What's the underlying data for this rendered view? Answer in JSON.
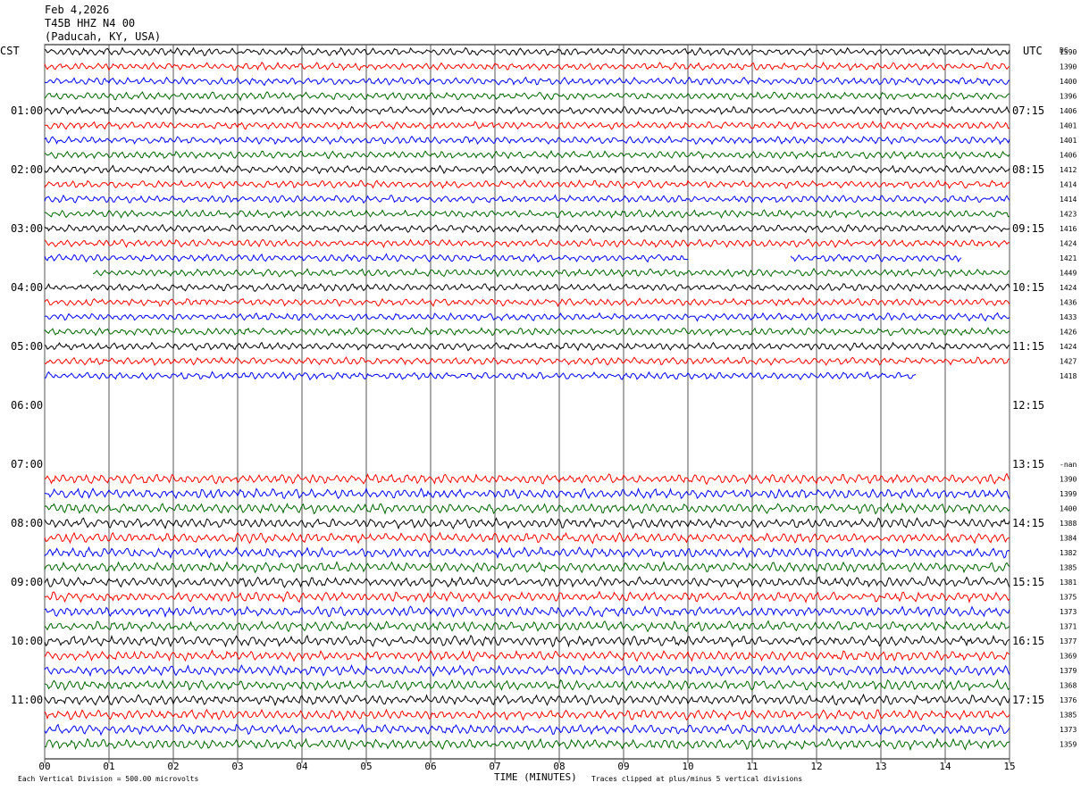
{
  "header": {
    "date": "Feb 4,2026",
    "station": "T45B HHZ N4 00",
    "location": "(Paducah, KY, USA)"
  },
  "left_tz": "CST",
  "right_tz": "UTC",
  "dc_label": "DC",
  "footer": {
    "vertical_division": "Each Vertical Division =  500.00 microvolts",
    "xlabel": "TIME (MINUTES)",
    "clip_note": "Traces clipped at plus/minus 5 vertical divisions"
  },
  "chart_data": {
    "type": "line",
    "title": "T45B HHZ N4 00",
    "xlabel": "TIME (MINUTES)",
    "xlim": [
      0,
      15
    ],
    "x_ticks": [
      "00",
      "01",
      "02",
      "03",
      "04",
      "05",
      "06",
      "07",
      "08",
      "09",
      "10",
      "11",
      "12",
      "13",
      "14",
      "15"
    ],
    "row_count": 48,
    "rows_per_hour": 4,
    "left_hour_labels": [
      "01:00",
      "02:00",
      "03:00",
      "04:00",
      "05:00",
      "06:00",
      "07:00",
      "08:00",
      "09:00",
      "10:00",
      "11:00"
    ],
    "right_hour_labels": [
      "07:15",
      "08:15",
      "09:15",
      "10:15",
      "11:15",
      "12:15",
      "13:15",
      "14:15",
      "15:15",
      "16:15",
      "17:15"
    ],
    "trace_colors": [
      "#000000",
      "#ff0000",
      "#0000ff",
      "#006400"
    ],
    "traces": [
      {
        "row": 0,
        "color": "#000000",
        "dc": "1390"
      },
      {
        "row": 1,
        "color": "#ff0000",
        "dc": "1390"
      },
      {
        "row": 2,
        "color": "#0000ff",
        "dc": "1400"
      },
      {
        "row": 3,
        "color": "#006400",
        "dc": "1396"
      },
      {
        "row": 4,
        "color": "#000000",
        "dc": "1406"
      },
      {
        "row": 5,
        "color": "#ff0000",
        "dc": "1401"
      },
      {
        "row": 6,
        "color": "#0000ff",
        "dc": "1401"
      },
      {
        "row": 7,
        "color": "#006400",
        "dc": "1406"
      },
      {
        "row": 8,
        "color": "#000000",
        "dc": "1412"
      },
      {
        "row": 9,
        "color": "#ff0000",
        "dc": "1414"
      },
      {
        "row": 10,
        "color": "#0000ff",
        "dc": "1414"
      },
      {
        "row": 11,
        "color": "#006400",
        "dc": "1423"
      },
      {
        "row": 12,
        "color": "#000000",
        "dc": "1416"
      },
      {
        "row": 13,
        "color": "#ff0000",
        "dc": "1424"
      },
      {
        "row": 14,
        "color": "#0000ff",
        "dc": "1421",
        "segments": [
          [
            0,
            10.0
          ],
          [
            11.6,
            14.25
          ]
        ]
      },
      {
        "row": 15,
        "color": "#006400",
        "dc": "1449",
        "segments": [
          [
            0.75,
            8.0
          ],
          [
            8.0,
            15.0
          ]
        ]
      },
      {
        "row": 16,
        "color": "#000000",
        "dc": "1424"
      },
      {
        "row": 17,
        "color": "#ff0000",
        "dc": "1436"
      },
      {
        "row": 18,
        "color": "#0000ff",
        "dc": "1433"
      },
      {
        "row": 19,
        "color": "#006400",
        "dc": "1426"
      },
      {
        "row": 20,
        "color": "#000000",
        "dc": "1424"
      },
      {
        "row": 21,
        "color": "#ff0000",
        "dc": "1427"
      },
      {
        "row": 22,
        "color": "#0000ff",
        "dc": "1418",
        "segments": [
          [
            0,
            13.55
          ]
        ]
      },
      {
        "row": 28,
        "color": "#000000",
        "dc": "-nan",
        "segments": []
      },
      {
        "row": 29,
        "color": "#ff0000",
        "dc": "1390"
      },
      {
        "row": 30,
        "color": "#0000ff",
        "dc": "1399"
      },
      {
        "row": 31,
        "color": "#006400",
        "dc": "1400"
      },
      {
        "row": 32,
        "color": "#000000",
        "dc": "1388"
      },
      {
        "row": 33,
        "color": "#ff0000",
        "dc": "1384"
      },
      {
        "row": 34,
        "color": "#0000ff",
        "dc": "1382"
      },
      {
        "row": 35,
        "color": "#006400",
        "dc": "1385"
      },
      {
        "row": 36,
        "color": "#000000",
        "dc": "1381"
      },
      {
        "row": 37,
        "color": "#ff0000",
        "dc": "1375"
      },
      {
        "row": 38,
        "color": "#0000ff",
        "dc": "1373"
      },
      {
        "row": 39,
        "color": "#006400",
        "dc": "1371"
      },
      {
        "row": 40,
        "color": "#000000",
        "dc": "1377"
      },
      {
        "row": 41,
        "color": "#ff0000",
        "dc": "1369"
      },
      {
        "row": 42,
        "color": "#0000ff",
        "dc": "1379"
      },
      {
        "row": 43,
        "color": "#006400",
        "dc": "1368"
      },
      {
        "row": 44,
        "color": "#000000",
        "dc": "1376"
      },
      {
        "row": 45,
        "color": "#ff0000",
        "dc": "1385"
      },
      {
        "row": 46,
        "color": "#0000ff",
        "dc": "1373"
      },
      {
        "row": 47,
        "color": "#006400",
        "dc": "1359"
      }
    ]
  }
}
